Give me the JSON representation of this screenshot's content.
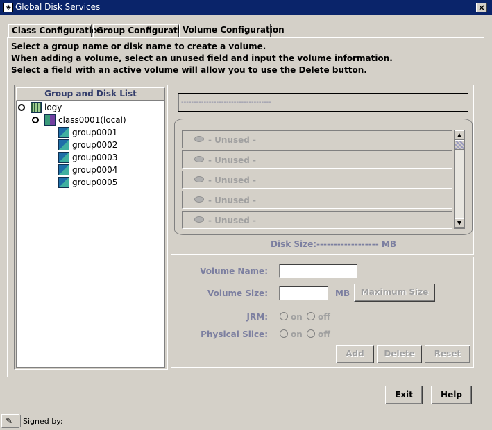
{
  "window": {
    "title": "Global Disk Services",
    "close_label": "×"
  },
  "tabs": [
    {
      "label": "Class Configuration",
      "active": false
    },
    {
      "label": "Group Configuration",
      "active": false
    },
    {
      "label": "Volume Configuration",
      "active": true
    }
  ],
  "instructions": [
    "Select a group name or disk name to create a volume.",
    "When adding a volume, select an unused field and input the volume information.",
    "Select a field with an active volume will allow you to use the Delete button."
  ],
  "tree": {
    "header": "Group and Disk List",
    "root": "logy",
    "class": "class0001(local)",
    "groups": [
      "group0001",
      "group0002",
      "group0003",
      "group0004",
      "group0005"
    ]
  },
  "volume_panel": {
    "name_placeholder": "------------------------------------",
    "rows": [
      "- Unused -",
      "- Unused -",
      "- Unused -",
      "- Unused -",
      "- Unused -"
    ],
    "disk_size": "Disk Size:------------------ MB"
  },
  "form": {
    "volume_name_label": "Volume Name:",
    "volume_size_label": "Volume Size:",
    "mb_unit": "MB",
    "max_size_button": "Maximum Size",
    "jrm_label": "JRM:",
    "physical_slice_label": "Physical Slice:",
    "on_label": "on",
    "off_label": "off",
    "add_button": "Add",
    "delete_button": "Delete",
    "reset_button": "Reset"
  },
  "footer": {
    "exit_button": "Exit",
    "help_button": "Help"
  },
  "status_bar": {
    "text": "Signed by:"
  }
}
